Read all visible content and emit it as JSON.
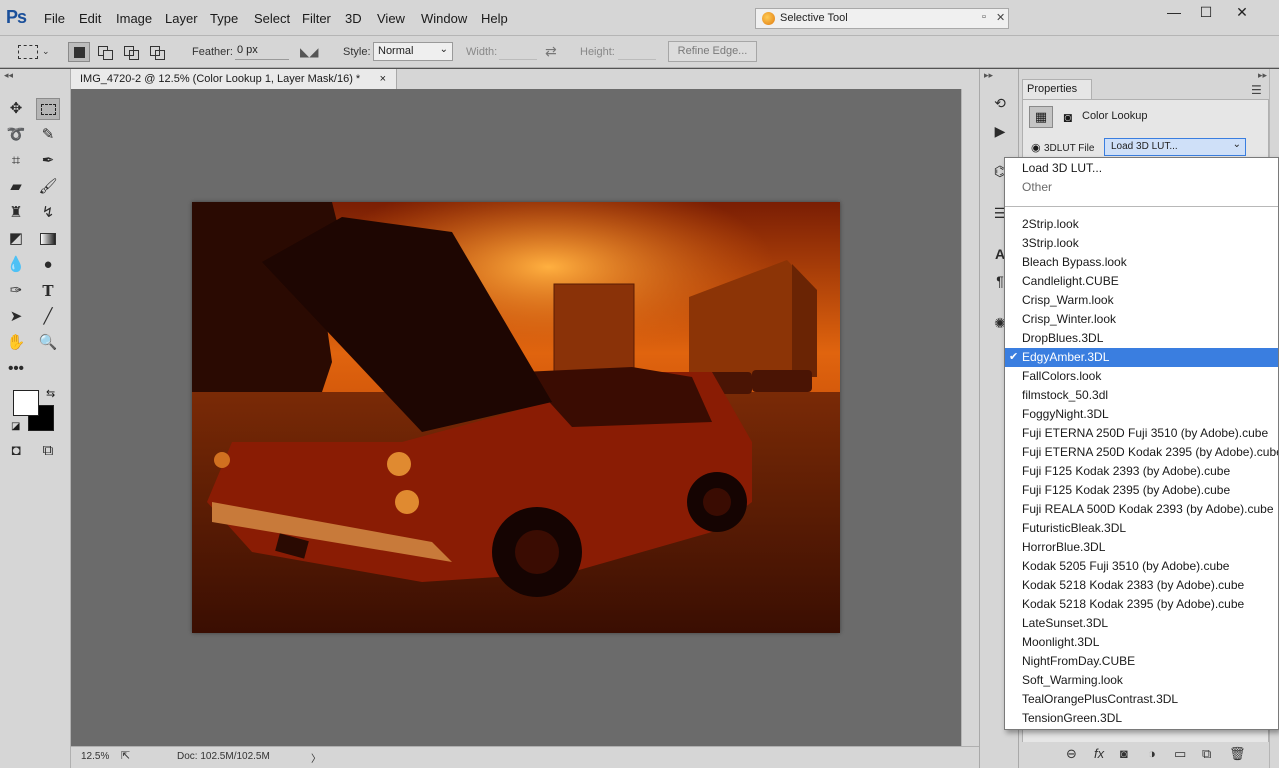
{
  "menubar": {
    "logo": "Ps",
    "items": [
      "File",
      "Edit",
      "Image",
      "Layer",
      "Type",
      "Select",
      "Filter",
      "3D",
      "View",
      "Window",
      "Help"
    ],
    "floating_panel_title": "Selective Tool",
    "window_controls": [
      "—",
      "☐",
      "✕"
    ]
  },
  "options": {
    "feather_label": "Feather:",
    "feather_value": "0 px",
    "style_label": "Style:",
    "style_value": "Normal",
    "width_label": "Width:",
    "height_label": "Height:",
    "refine_edge_label": "Refine Edge..."
  },
  "document": {
    "tab_title": "IMG_4720-2 @ 12.5% (Color Lookup 1, Layer Mask/16) *",
    "close_glyph": "×",
    "zoom": "12.5%",
    "doc_size": "Doc: 102.5M/102.5M",
    "status_arrow": "〉"
  },
  "properties": {
    "panel_title": "Properties",
    "adjustment_name": "Color Lookup",
    "lut_radio_label": "3DLUT File",
    "lut_select_value": "Load 3D LUT..."
  },
  "dropdown": {
    "top_items": [
      "Load 3D LUT...",
      "Other"
    ],
    "items": [
      "2Strip.look",
      "3Strip.look",
      "Bleach Bypass.look",
      "Candlelight.CUBE",
      "Crisp_Warm.look",
      "Crisp_Winter.look",
      "DropBlues.3DL",
      "EdgyAmber.3DL",
      "FallColors.look",
      "filmstock_50.3dl",
      "FoggyNight.3DL",
      "Fuji ETERNA 250D Fuji 3510 (by Adobe).cube",
      "Fuji ETERNA 250D Kodak 2395 (by Adobe).cube",
      "Fuji F125 Kodak 2393 (by Adobe).cube",
      "Fuji F125 Kodak 2395 (by Adobe).cube",
      "Fuji REALA 500D Kodak 2393 (by Adobe).cube",
      "FuturisticBleak.3DL",
      "HorrorBlue.3DL",
      "Kodak 5205 Fuji 3510 (by Adobe).cube",
      "Kodak 5218 Kodak 2383 (by Adobe).cube",
      "Kodak 5218 Kodak 2395 (by Adobe).cube",
      "LateSunset.3DL",
      "Moonlight.3DL",
      "NightFromDay.CUBE",
      "Soft_Warming.look",
      "TealOrangePlusContrast.3DL",
      "TensionGreen.3DL"
    ],
    "selected_item": "EdgyAmber.3DL",
    "check_glyph": "✔"
  },
  "colors": {
    "selection_highlight": "#3a7ee0",
    "photo_amber": "#c84a0a",
    "ps_blue": "#1a4f9a"
  }
}
